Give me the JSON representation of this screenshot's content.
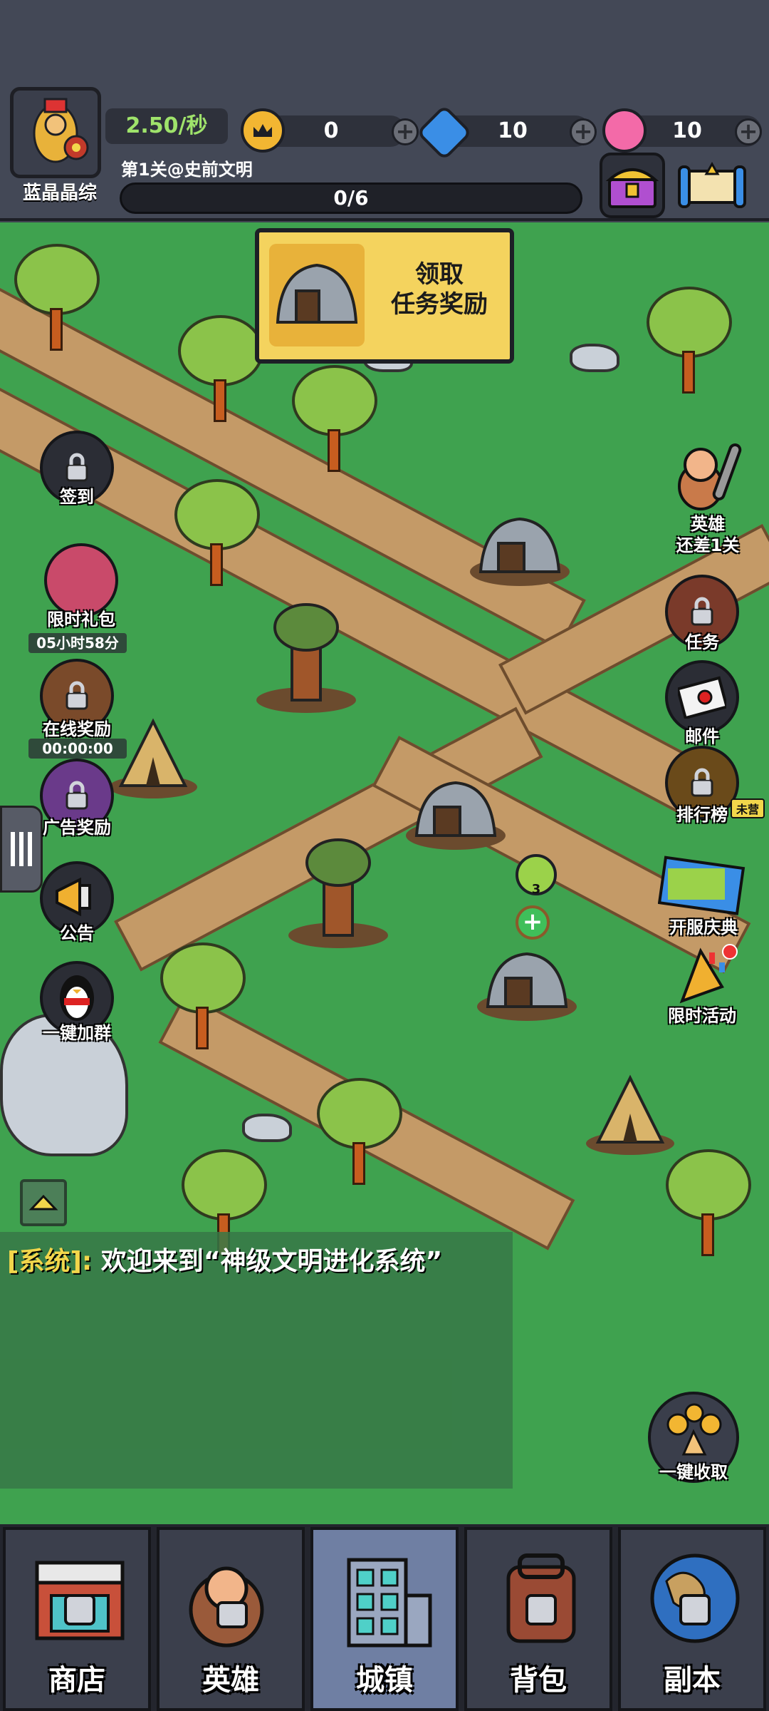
{
  "hud": {
    "player_name": "蓝晶晶综",
    "income_rate": "2.50/秒",
    "level_label": "第1关@史前文明",
    "progress_text": "0/6",
    "progress_fraction": 0,
    "resources": [
      {
        "name": "crown",
        "icon": "crown-coin-icon",
        "value": "0"
      },
      {
        "name": "gem",
        "icon": "blue-swirl-gem-icon",
        "value": "10"
      },
      {
        "name": "candy",
        "icon": "pink-candy-icon",
        "value": "10"
      }
    ]
  },
  "task": {
    "label": "领取\n任务奖励"
  },
  "left_buttons": {
    "sign_in": "签到",
    "limited_gift": "限时礼包",
    "limited_gift_timer": "05小时58分",
    "online_reward": "在线奖励",
    "online_timer": "00:00:00",
    "ad_reward": "广告奖励",
    "announcement": "公告",
    "join_group": "一键加群"
  },
  "right_buttons": {
    "hero_hint": "英雄\n还差1关",
    "task": "任务",
    "mail": "邮件",
    "leaderboard": "排行榜",
    "leaderboard_badge": "未营",
    "server_celebration": "开服庆典",
    "limited_event": "限时活动",
    "collect_all": "一键收取"
  },
  "chat": {
    "system_tag": "[系统]:",
    "message": "欢迎来到“神级文明进化系统”"
  },
  "map_badges": {
    "crown_level": "3"
  },
  "nav": [
    {
      "label": "商店",
      "icon": "shop-icon",
      "locked": true,
      "active": false
    },
    {
      "label": "英雄",
      "icon": "hero-icon",
      "locked": true,
      "active": false
    },
    {
      "label": "城镇",
      "icon": "town-building-icon",
      "locked": false,
      "active": true
    },
    {
      "label": "背包",
      "icon": "backpack-icon",
      "locked": true,
      "active": false
    },
    {
      "label": "副本",
      "icon": "globe-dungeon-icon",
      "locked": true,
      "active": false
    }
  ],
  "colors": {
    "grass": "#3fa24f",
    "path": "#c49a67",
    "hud": "#434856",
    "accent_green": "#9fe36b",
    "task_card": "#f4d35e"
  }
}
